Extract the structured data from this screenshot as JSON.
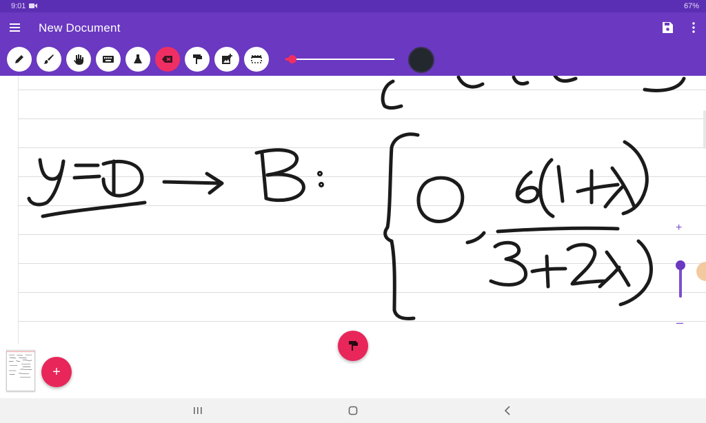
{
  "status_bar": {
    "time": "9:01",
    "battery": "67%"
  },
  "app_bar": {
    "title": "New Document"
  },
  "toolbar": {
    "tools": [
      {
        "name": "pen-icon"
      },
      {
        "name": "brush-icon"
      },
      {
        "name": "hand-icon"
      },
      {
        "name": "keyboard-icon"
      },
      {
        "name": "flask-icon"
      },
      {
        "name": "eraser-icon",
        "active": true
      },
      {
        "name": "format-paint-icon"
      },
      {
        "name": "add-image-icon"
      },
      {
        "name": "selection-icon"
      }
    ],
    "stroke_color": "#22282d"
  },
  "zoom": {
    "plus": "+",
    "minus": "–"
  },
  "bottom": {
    "add_label": "+"
  },
  "colors": {
    "primary": "#6a38c1",
    "accent": "#e8265a",
    "ink": "#1b1b1b"
  }
}
